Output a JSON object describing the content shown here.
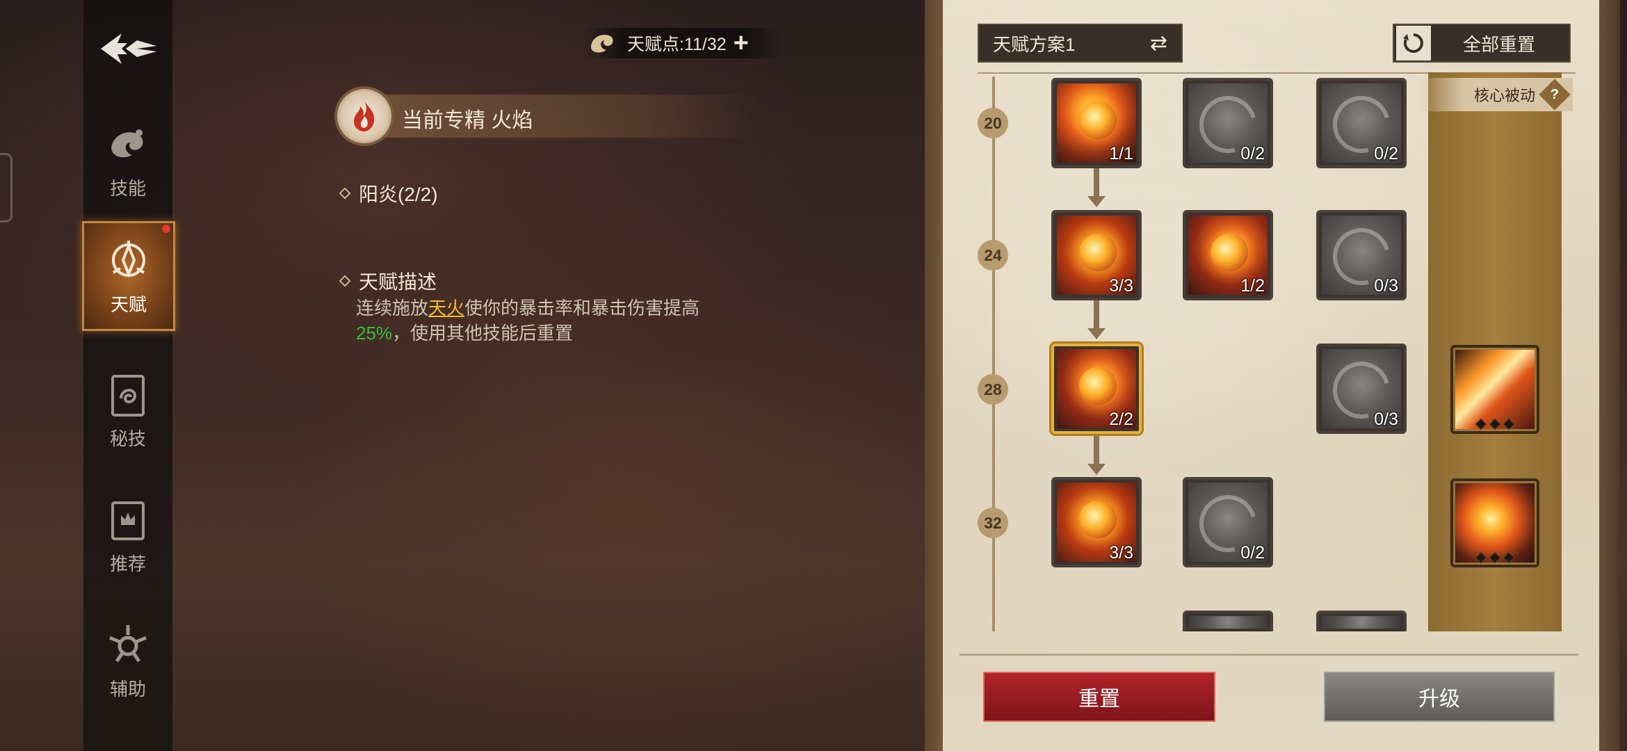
{
  "nav": {
    "items": [
      {
        "label": "技能",
        "icon": "skill-icon"
      },
      {
        "label": "天赋",
        "icon": "talent-icon",
        "active": true
      },
      {
        "label": "秘技",
        "icon": "secret-skill-icon"
      },
      {
        "label": "推荐",
        "icon": "recommend-icon"
      },
      {
        "label": "辅助",
        "icon": "assist-icon"
      }
    ]
  },
  "header": {
    "points_text": "天赋点:11/32",
    "plus_label": "+"
  },
  "spec": {
    "label": "当前专精 火焰"
  },
  "talent": {
    "name": "阳炎(2/2)",
    "desc_title": "天赋描述",
    "desc_part1": "连续施放",
    "desc_highlight": "天火",
    "desc_part2": "使你的暴击率和暴击伤害提高",
    "desc_percent": "25%",
    "desc_part3": "，使用其他技能后重置"
  },
  "panel": {
    "plan_label": "天赋方案1",
    "swap_symbol": "⇄",
    "reset_all_label": "全部重置",
    "core_label": "核心被动",
    "core_help": "?",
    "levels": [
      "20",
      "24",
      "28",
      "32"
    ],
    "nodes": {
      "r20c1": "1/1",
      "r20c2": "0/2",
      "r20c3": "0/2",
      "r24c1": "3/3",
      "r24c2": "1/2",
      "r24c3": "0/3",
      "r28c1": "2/2",
      "r28c3": "0/3",
      "r32c1": "3/3",
      "r32c2": "0/2"
    },
    "reset_label": "重置",
    "upgrade_label": "升级"
  },
  "colors": {
    "highlight": "#f0c02a",
    "percent": "#37c23b",
    "reset_button": "#b2242a",
    "selected_border": "#e6b23a"
  }
}
